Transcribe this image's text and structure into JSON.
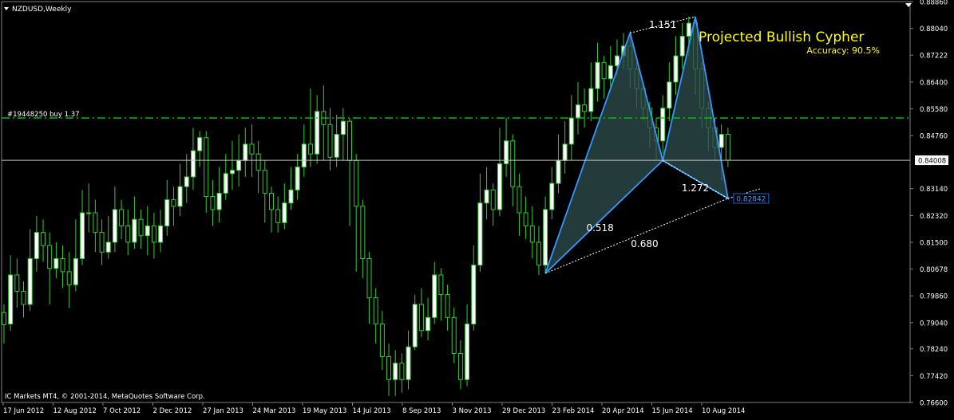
{
  "window": {
    "symbol_label": "NZDUSD,Weekly",
    "copyright": "IC Markets MT4, © 2001-2014, MetaQuotes Software Corp."
  },
  "colors": {
    "background": "#000000",
    "candle_bull": "#FFFFFF",
    "candle_bear": "#000000",
    "candle_outline": "#33CC33",
    "wick": "#33CC33",
    "pattern_fill": "#2F4F4F",
    "pattern_edge": "#3399FF",
    "order_line": "#00CC00",
    "current_price_line": "#C0C0C0",
    "title": "#FFFF00",
    "axis_text": "#FFFFFF",
    "target_box": "#1E66CC"
  },
  "chart_data": {
    "type": "candlestick",
    "symbol": "NZDUSD",
    "timeframe": "Weekly",
    "title": "Projected Bullish Cypher",
    "subtitle": "Accuracy: 90.5%",
    "ylim": [
      0.766,
      0.8886
    ],
    "y_ticks": [
      "0.88860",
      "0.88040",
      "0.87222",
      "0.86400",
      "0.85580",
      "0.84760",
      "0.83140",
      "0.82320",
      "0.81500",
      "0.80678",
      "0.79860",
      "0.79040",
      "0.78240",
      "0.77420",
      "0.76600"
    ],
    "x_ticks": [
      "17 Jun 2012",
      "12 Aug 2012",
      "7 Oct 2012",
      "2 Dec 2012",
      "27 Jan 2013",
      "24 Mar 2013",
      "19 May 2013",
      "14 Jul 2013",
      "8 Sep 2013",
      "3 Nov 2013",
      "29 Dec 2013",
      "23 Feb 2014",
      "20 Apr 2014",
      "15 Jun 2014",
      "10 Aug 2014"
    ],
    "current_price": "0.84008",
    "order_line": {
      "label": "#19448250 buy 1.37",
      "price": 0.853
    },
    "pattern": {
      "X": {
        "bar": 83,
        "price": 0.8055
      },
      "A": {
        "bar": 96,
        "price": 0.879
      },
      "B": {
        "bar": 101,
        "price": 0.84
      },
      "C": {
        "bar": 106,
        "price": 0.884
      },
      "D": {
        "bar": 111,
        "price": 0.8284
      },
      "target_label": "0.82842",
      "ratios": {
        "xb": "0.518",
        "ac": "1.151",
        "bd": "1.272",
        "xd": "0.680"
      }
    },
    "candles": [
      [
        0.7935,
        0.7898,
        0.796,
        0.784
      ],
      [
        0.79,
        0.805,
        0.811,
        0.788
      ],
      [
        0.805,
        0.8,
        0.81,
        0.795
      ],
      [
        0.8,
        0.796,
        0.803,
        0.792
      ],
      [
        0.796,
        0.81,
        0.819,
        0.794
      ],
      [
        0.81,
        0.818,
        0.823,
        0.806
      ],
      [
        0.818,
        0.814,
        0.822,
        0.809
      ],
      [
        0.814,
        0.807,
        0.818,
        0.796
      ],
      [
        0.807,
        0.81,
        0.815,
        0.804
      ],
      [
        0.81,
        0.806,
        0.814,
        0.801
      ],
      [
        0.806,
        0.802,
        0.812,
        0.795
      ],
      [
        0.802,
        0.81,
        0.822,
        0.8
      ],
      [
        0.81,
        0.824,
        0.831,
        0.808
      ],
      [
        0.824,
        0.824,
        0.833,
        0.818
      ],
      [
        0.824,
        0.818,
        0.828,
        0.812
      ],
      [
        0.818,
        0.812,
        0.822,
        0.808
      ],
      [
        0.812,
        0.815,
        0.823,
        0.81
      ],
      [
        0.815,
        0.825,
        0.832,
        0.812
      ],
      [
        0.825,
        0.82,
        0.828,
        0.816
      ],
      [
        0.82,
        0.815,
        0.825,
        0.811
      ],
      [
        0.815,
        0.822,
        0.829,
        0.813
      ],
      [
        0.822,
        0.817,
        0.825,
        0.813
      ],
      [
        0.817,
        0.82,
        0.826,
        0.811
      ],
      [
        0.82,
        0.815,
        0.824,
        0.81
      ],
      [
        0.815,
        0.82,
        0.825,
        0.812
      ],
      [
        0.82,
        0.828,
        0.834,
        0.817
      ],
      [
        0.828,
        0.826,
        0.832,
        0.82
      ],
      [
        0.826,
        0.832,
        0.839,
        0.823
      ],
      [
        0.832,
        0.835,
        0.842,
        0.827
      ],
      [
        0.835,
        0.843,
        0.85,
        0.831
      ],
      [
        0.843,
        0.847,
        0.849,
        0.838
      ],
      [
        0.847,
        0.829,
        0.849,
        0.824
      ],
      [
        0.829,
        0.825,
        0.834,
        0.82
      ],
      [
        0.825,
        0.83,
        0.838,
        0.821
      ],
      [
        0.83,
        0.836,
        0.842,
        0.828
      ],
      [
        0.836,
        0.837,
        0.846,
        0.831
      ],
      [
        0.837,
        0.84,
        0.848,
        0.832
      ],
      [
        0.84,
        0.845,
        0.85,
        0.835
      ],
      [
        0.845,
        0.842,
        0.851,
        0.835
      ],
      [
        0.842,
        0.837,
        0.846,
        0.83
      ],
      [
        0.837,
        0.83,
        0.84,
        0.821
      ],
      [
        0.83,
        0.825,
        0.832,
        0.818
      ],
      [
        0.825,
        0.821,
        0.829,
        0.818
      ],
      [
        0.821,
        0.827,
        0.833,
        0.819
      ],
      [
        0.827,
        0.831,
        0.838,
        0.825
      ],
      [
        0.831,
        0.838,
        0.842,
        0.828
      ],
      [
        0.838,
        0.845,
        0.851,
        0.835
      ],
      [
        0.845,
        0.842,
        0.862,
        0.838
      ],
      [
        0.842,
        0.855,
        0.86,
        0.839
      ],
      [
        0.855,
        0.851,
        0.863,
        0.84
      ],
      [
        0.851,
        0.841,
        0.856,
        0.837
      ],
      [
        0.841,
        0.848,
        0.854,
        0.838
      ],
      [
        0.848,
        0.852,
        0.856,
        0.84
      ],
      [
        0.852,
        0.84,
        0.853,
        0.82
      ],
      [
        0.84,
        0.826,
        0.842,
        0.806
      ],
      [
        0.826,
        0.81,
        0.828,
        0.804
      ],
      [
        0.81,
        0.798,
        0.812,
        0.79
      ],
      [
        0.798,
        0.79,
        0.801,
        0.784
      ],
      [
        0.79,
        0.78,
        0.794,
        0.776
      ],
      [
        0.78,
        0.773,
        0.784,
        0.768
      ],
      [
        0.773,
        0.778,
        0.782,
        0.768
      ],
      [
        0.778,
        0.773,
        0.781,
        0.769
      ],
      [
        0.773,
        0.783,
        0.788,
        0.77
      ],
      [
        0.783,
        0.796,
        0.799,
        0.782
      ],
      [
        0.796,
        0.788,
        0.801,
        0.786
      ],
      [
        0.788,
        0.792,
        0.798,
        0.785
      ],
      [
        0.792,
        0.805,
        0.809,
        0.79
      ],
      [
        0.805,
        0.799,
        0.807,
        0.791
      ],
      [
        0.799,
        0.792,
        0.802,
        0.788
      ],
      [
        0.792,
        0.781,
        0.795,
        0.778
      ],
      [
        0.781,
        0.773,
        0.785,
        0.77
      ],
      [
        0.773,
        0.79,
        0.796,
        0.771
      ],
      [
        0.79,
        0.808,
        0.814,
        0.788
      ],
      [
        0.808,
        0.827,
        0.836,
        0.806
      ],
      [
        0.827,
        0.831,
        0.838,
        0.822
      ],
      [
        0.831,
        0.825,
        0.833,
        0.82
      ],
      [
        0.825,
        0.839,
        0.85,
        0.823
      ],
      [
        0.839,
        0.846,
        0.853,
        0.835
      ],
      [
        0.846,
        0.832,
        0.848,
        0.826
      ],
      [
        0.832,
        0.824,
        0.836,
        0.817
      ],
      [
        0.824,
        0.82,
        0.829,
        0.816
      ],
      [
        0.82,
        0.815,
        0.826,
        0.81
      ],
      [
        0.815,
        0.808,
        0.82,
        0.805
      ],
      [
        0.808,
        0.825,
        0.829,
        0.8055
      ],
      [
        0.825,
        0.833,
        0.838,
        0.822
      ],
      [
        0.833,
        0.84,
        0.848,
        0.83
      ],
      [
        0.84,
        0.845,
        0.852,
        0.836
      ],
      [
        0.845,
        0.853,
        0.86,
        0.84
      ],
      [
        0.853,
        0.857,
        0.864,
        0.848
      ],
      [
        0.857,
        0.855,
        0.862,
        0.85
      ],
      [
        0.855,
        0.862,
        0.87,
        0.852
      ],
      [
        0.862,
        0.87,
        0.876,
        0.858
      ],
      [
        0.87,
        0.865,
        0.872,
        0.859
      ],
      [
        0.865,
        0.869,
        0.875,
        0.862
      ],
      [
        0.869,
        0.872,
        0.877,
        0.866
      ],
      [
        0.872,
        0.875,
        0.879,
        0.868
      ],
      [
        0.875,
        0.868,
        0.878,
        0.862
      ],
      [
        0.868,
        0.862,
        0.87,
        0.856
      ],
      [
        0.862,
        0.856,
        0.864,
        0.852
      ],
      [
        0.856,
        0.85,
        0.858,
        0.844
      ],
      [
        0.85,
        0.846,
        0.853,
        0.84
      ],
      [
        0.846,
        0.856,
        0.86,
        0.842
      ],
      [
        0.856,
        0.864,
        0.87,
        0.852
      ],
      [
        0.864,
        0.872,
        0.878,
        0.86
      ],
      [
        0.872,
        0.878,
        0.882,
        0.868
      ],
      [
        0.878,
        0.882,
        0.884,
        0.872
      ],
      [
        0.882,
        0.868,
        0.8835,
        0.86
      ],
      [
        0.868,
        0.856,
        0.87,
        0.85
      ],
      [
        0.856,
        0.85,
        0.858,
        0.843
      ],
      [
        0.85,
        0.844,
        0.853,
        0.84
      ],
      [
        0.844,
        0.848,
        0.851,
        0.834
      ],
      [
        0.848,
        0.8401,
        0.85,
        0.838
      ]
    ]
  }
}
